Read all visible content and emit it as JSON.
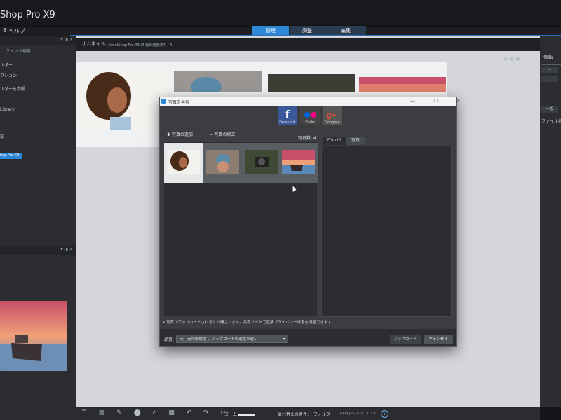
{
  "app": {
    "title": "Shop Pro X9",
    "menu_help": "ヘルプ"
  },
  "workflow_tabs": {
    "manage": "管理",
    "adjust": "調整",
    "edit": "編集"
  },
  "left_panel": {
    "quick_search": "クイック検索",
    "items": [
      "ルダー",
      "クション",
      "ルダーを参照",
      "Library",
      "知"
    ],
    "selected": "hop Pro X9",
    "header_icons": "▾ ◨ ×"
  },
  "thumbnail": {
    "label": "サムネイル",
    "breadcrumb": "▸  PaintShop Pro X9  (4 個の選択済み / 4"
  },
  "right_panel": {
    "info_label": "情報",
    "buttons": [
      "⋯",
      "⋯",
      "⋯"
    ],
    "file_name": "ファイル名",
    "sub_button": "一般"
  },
  "dialog": {
    "title": "写真を共有",
    "controls": "—  ☐  ✕",
    "services": [
      {
        "label": "Facebook",
        "glyph": "f"
      },
      {
        "label": "Flickr",
        "glyph": "●●"
      },
      {
        "label": "Google+",
        "glyph": "g+"
      }
    ],
    "add_photo": "✚  写真の追加",
    "remove_photo": "━  写真の除去",
    "photo_count": "写真数: 4",
    "tabs": {
      "album": "アルバム",
      "photo": "写真"
    },
    "note": "• 写真がアップロードされると公開されます。共有サイトで直接プライバシー設定を調整できます。",
    "quality_label": "品質:",
    "quality_value": "元 - 元の解像度 。アップロードの速度が遅い",
    "upload_button": "アップロード",
    "cancel_button": "キャンセル"
  },
  "bottom_bar": {
    "icons": "☰ ▤ ✎ ⬤ ⌂ ▦ ↶ ↷ ✂",
    "zoom_label": "ズーム",
    "sort_label": "並べ替えの条件:",
    "sort_value": "フォルダー",
    "raw_label": "RAW/JPG ペア: オフ ▾",
    "info_glyph": "i"
  },
  "colors": {
    "accent": "#2e88d8",
    "facebook": "#3b5998",
    "dialog_bg": "#3b3d41",
    "panel_bg": "#2b2d31"
  }
}
